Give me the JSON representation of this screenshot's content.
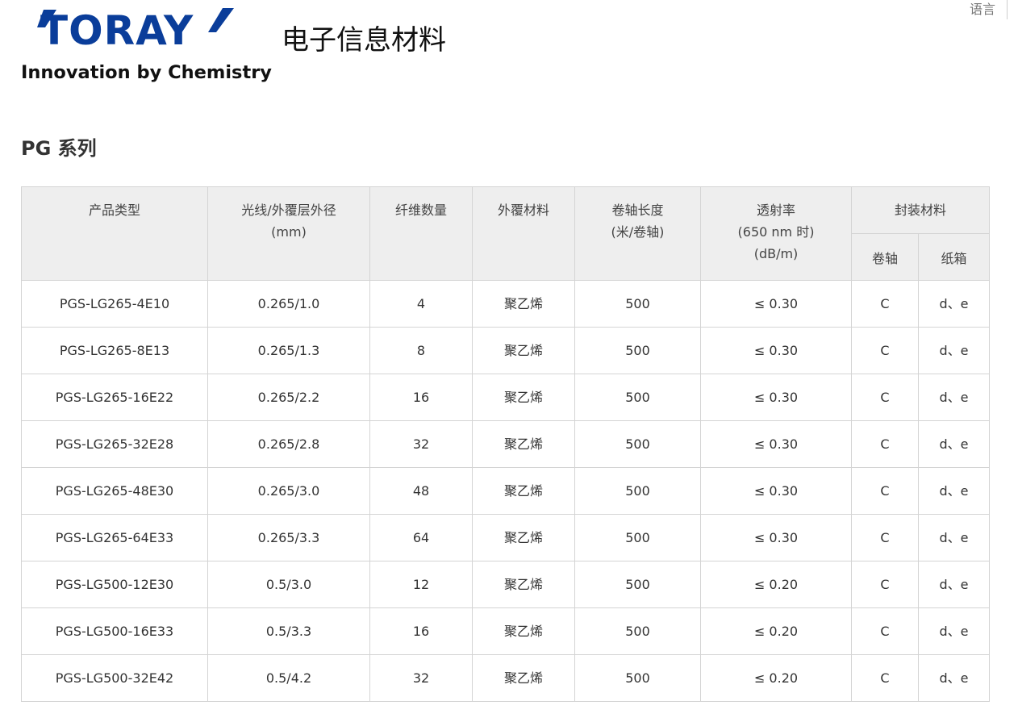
{
  "header": {
    "logo_word": "TORAY",
    "logo_tagline": "Innovation by Chemistry",
    "site_title": "电子信息材料",
    "language_label": "语言",
    "colors": {
      "logo_blue": "#0a3d9a",
      "header_bg": "#eeeeee",
      "border": "#d4d4d4"
    }
  },
  "section": {
    "title": "PG 系列"
  },
  "table": {
    "headers": {
      "product_type": "产品类型",
      "diameter_line1": "光线/外覆层外径",
      "diameter_line2": "(mm)",
      "fiber_count": "纤维数量",
      "jacket": "外覆材料",
      "reel_length_line1": "卷轴长度",
      "reel_length_line2": "(米/卷轴)",
      "transmittance_line1": "透射率",
      "transmittance_line2": "(650 nm 时)",
      "transmittance_line3": "(dB/m)",
      "packaging": "封装材料",
      "reel": "卷轴",
      "carton": "纸箱"
    },
    "rows": [
      {
        "product": "PGS-LG265-4E10",
        "diameter": "0.265/1.0",
        "count": "4",
        "jacket": "聚乙烯",
        "length": "500",
        "transmittance": "≤ 0.30",
        "reel": "C",
        "carton": "d、e"
      },
      {
        "product": "PGS-LG265-8E13",
        "diameter": "0.265/1.3",
        "count": "8",
        "jacket": "聚乙烯",
        "length": "500",
        "transmittance": "≤ 0.30",
        "reel": "C",
        "carton": "d、e"
      },
      {
        "product": "PGS-LG265-16E22",
        "diameter": "0.265/2.2",
        "count": "16",
        "jacket": "聚乙烯",
        "length": "500",
        "transmittance": "≤ 0.30",
        "reel": "C",
        "carton": "d、e"
      },
      {
        "product": "PGS-LG265-32E28",
        "diameter": "0.265/2.8",
        "count": "32",
        "jacket": "聚乙烯",
        "length": "500",
        "transmittance": "≤ 0.30",
        "reel": "C",
        "carton": "d、e"
      },
      {
        "product": "PGS-LG265-48E30",
        "diameter": "0.265/3.0",
        "count": "48",
        "jacket": "聚乙烯",
        "length": "500",
        "transmittance": "≤ 0.30",
        "reel": "C",
        "carton": "d、e"
      },
      {
        "product": "PGS-LG265-64E33",
        "diameter": "0.265/3.3",
        "count": "64",
        "jacket": "聚乙烯",
        "length": "500",
        "transmittance": "≤ 0.30",
        "reel": "C",
        "carton": "d、e"
      },
      {
        "product": "PGS-LG500-12E30",
        "diameter": "0.5/3.0",
        "count": "12",
        "jacket": "聚乙烯",
        "length": "500",
        "transmittance": "≤ 0.20",
        "reel": "C",
        "carton": "d、e"
      },
      {
        "product": "PGS-LG500-16E33",
        "diameter": "0.5/3.3",
        "count": "16",
        "jacket": "聚乙烯",
        "length": "500",
        "transmittance": "≤ 0.20",
        "reel": "C",
        "carton": "d、e"
      },
      {
        "product": "PGS-LG500-32E42",
        "diameter": "0.5/4.2",
        "count": "32",
        "jacket": "聚乙烯",
        "length": "500",
        "transmittance": "≤ 0.20",
        "reel": "C",
        "carton": "d、e"
      }
    ]
  }
}
